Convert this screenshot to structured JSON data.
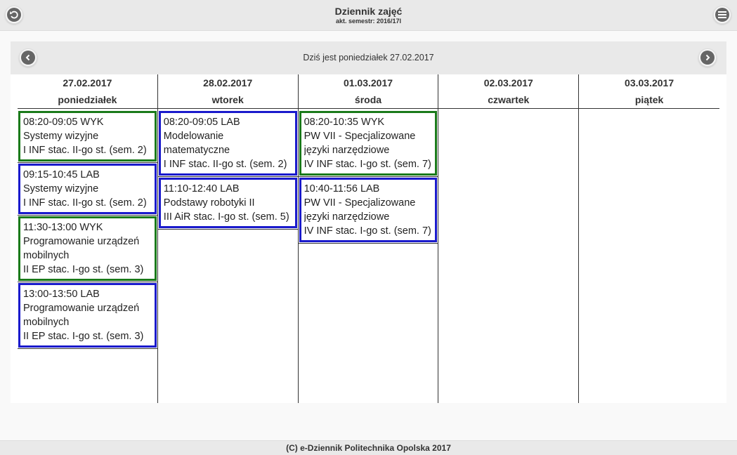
{
  "header": {
    "title": "Dziennik zajęć",
    "subtitle": "akt. semestr: 2016/17l",
    "back_icon": "back-arrow-icon",
    "menu_icon": "hamburger-menu-icon"
  },
  "date_bar": {
    "today": "Dziś jest poniedziałek 27.02.2017",
    "prev_icon": "chevron-left-icon",
    "next_icon": "chevron-right-icon"
  },
  "colors": {
    "wyk": "#1a7a1a",
    "lab": "#1a1acc"
  },
  "days": [
    {
      "date": "27.02.2017",
      "name": "poniedziałek",
      "events": [
        {
          "type": "wyk",
          "time": "08:20-09:05 WYK",
          "subject": "Systemy wizyjne",
          "group": "I INF stac. II-go st. (sem. 2)"
        },
        {
          "type": "lab",
          "time": "09:15-10:45 LAB",
          "subject": "Systemy wizyjne",
          "group": "I INF stac. II-go st. (sem. 2)"
        },
        {
          "type": "wyk",
          "time": "11:30-13:00 WYK",
          "subject": "Programowanie urządzeń mobilnych",
          "group": "II EP stac. I-go st. (sem. 3)"
        },
        {
          "type": "lab",
          "time": "13:00-13:50 LAB",
          "subject": "Programowanie urządzeń mobilnych",
          "group": "II EP stac. I-go st. (sem. 3)"
        }
      ]
    },
    {
      "date": "28.02.2017",
      "name": "wtorek",
      "events": [
        {
          "type": "lab",
          "time": "08:20-09:05 LAB",
          "subject": "Modelowanie matematyczne",
          "group": "I INF stac. II-go st. (sem. 2)"
        },
        {
          "type": "lab",
          "time": "11:10-12:40 LAB",
          "subject": "Podstawy robotyki II",
          "group": "III AiR stac. I-go st. (sem. 5)"
        }
      ]
    },
    {
      "date": "01.03.2017",
      "name": "środa",
      "events": [
        {
          "type": "wyk",
          "time": "08:20-10:35 WYK",
          "subject": "PW VII - Specjalizowane języki narzędziowe",
          "group": "IV INF stac. I-go st. (sem. 7)"
        },
        {
          "type": "lab",
          "time": "10:40-11:56 LAB",
          "subject": "PW VII - Specjalizowane języki narzędziowe",
          "group": "IV INF stac. I-go st. (sem. 7)"
        }
      ]
    },
    {
      "date": "02.03.2017",
      "name": "czwartek",
      "events": []
    },
    {
      "date": "03.03.2017",
      "name": "piątek",
      "events": []
    }
  ],
  "footer": {
    "text": "(C) e-Dziennik Politechnika Opolska 2017"
  }
}
